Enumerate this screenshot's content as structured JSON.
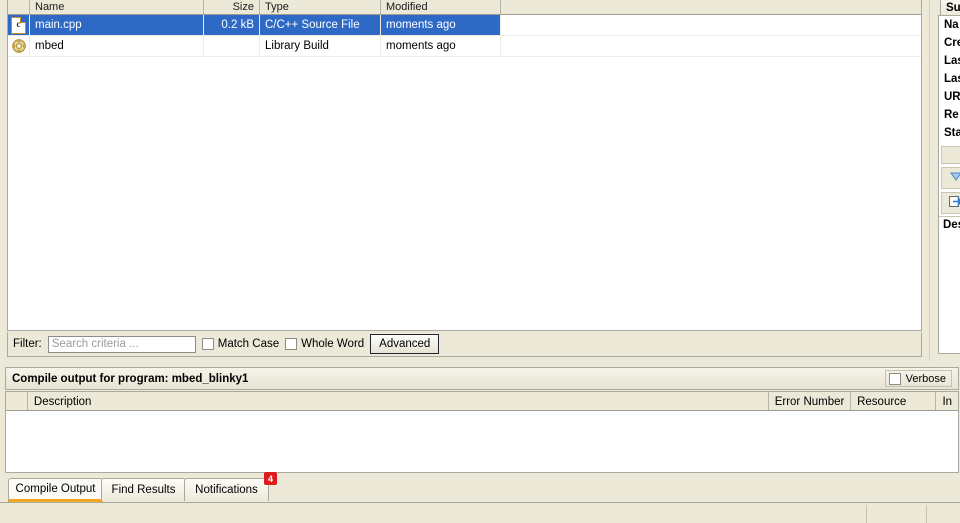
{
  "file_browser": {
    "columns": [
      {
        "key": "icon",
        "label": ""
      },
      {
        "key": "name",
        "label": "Name"
      },
      {
        "key": "size",
        "label": "Size"
      },
      {
        "key": "type",
        "label": "Type"
      },
      {
        "key": "mod",
        "label": "Modified"
      }
    ],
    "rows": [
      {
        "icon": "c-source-file-icon",
        "name": "main.cpp",
        "size": "0.2 kB",
        "type": "C/C++ Source File",
        "modified": "moments ago",
        "selected": true
      },
      {
        "icon": "library-build-icon",
        "name": "mbed",
        "size": "",
        "type": "Library Build",
        "modified": "moments ago",
        "selected": false
      }
    ]
  },
  "filter_bar": {
    "label": "Filter:",
    "placeholder": "Search criteria ...",
    "value": "",
    "match_case_label": "Match Case",
    "match_case_checked": false,
    "whole_word_label": "Whole Word",
    "whole_word_checked": false,
    "advanced_label": "Advanced"
  },
  "details_panel": {
    "tab_label": "Su",
    "properties": [
      "Na",
      "Cre",
      "Las",
      "Las",
      "UR",
      "Re",
      "Sta"
    ],
    "description_label": "Des",
    "icon_buttons": [
      "chevron-down-icon",
      "export-arrow-icon"
    ]
  },
  "output_panel": {
    "title": "Compile output for program: mbed_blinky1",
    "verbose_label": "Verbose",
    "verbose_checked": false,
    "columns": [
      "",
      "Description",
      "Error Number",
      "Resource",
      "In"
    ],
    "rows": []
  },
  "bottom_tabs": [
    {
      "label": "Compile Output",
      "active": true,
      "badge": ""
    },
    {
      "label": "Find Results",
      "active": false,
      "badge": ""
    },
    {
      "label": "Notifications",
      "active": false,
      "badge": "4"
    }
  ],
  "colors": {
    "selection_blue": "#2f69c6",
    "panel_bg": "#ece9d8",
    "accent_orange": "#f5a820",
    "badge_red": "#e01b1b"
  }
}
